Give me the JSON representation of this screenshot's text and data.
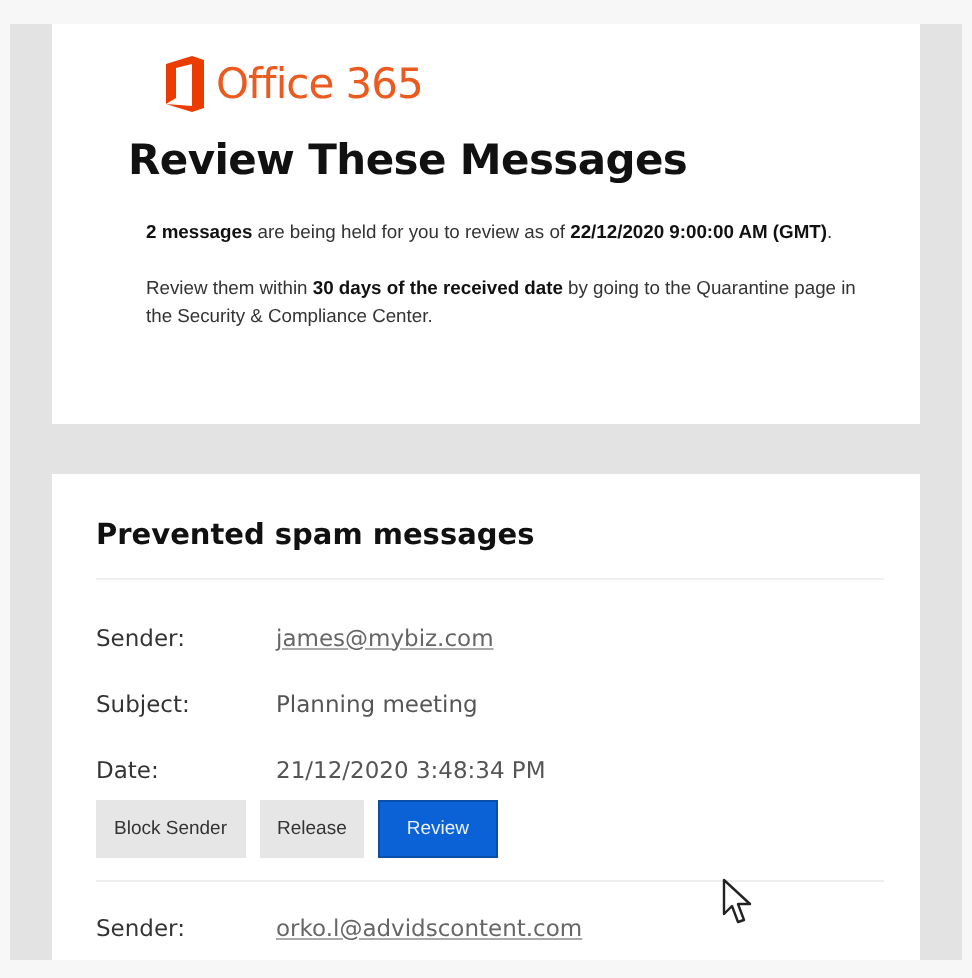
{
  "logo": {
    "text": "Office 365"
  },
  "heading": "Review These Messages",
  "paragraphs": [
    "**2 messages** are being held for you to review as of **22/12/2020 9:00:00 AM (GMT)**.",
    "Review them within **30 days of the received date** by going to the Quarantine page in the Security & Compliance Center."
  ],
  "section": {
    "title": "Prevented spam messages",
    "messages": [
      {
        "fields": [
          {
            "label": "Sender:",
            "value": "james@mybiz.com",
            "kind": "link"
          },
          {
            "label": "Subject:",
            "value": "Planning meeting",
            "kind": "text"
          },
          {
            "label": "Date:",
            "value": "21/12/2020 3:48:34 PM",
            "kind": "text"
          }
        ],
        "buttons": [
          {
            "label": "Block Sender",
            "kind": "secondary"
          },
          {
            "label": "Release",
            "kind": "secondary"
          },
          {
            "label": "Review",
            "kind": "primary"
          }
        ]
      },
      {
        "fields": [
          {
            "label": "Sender:",
            "value": "orko.l@advidscontent.com",
            "kind": "link"
          }
        ]
      }
    ]
  }
}
